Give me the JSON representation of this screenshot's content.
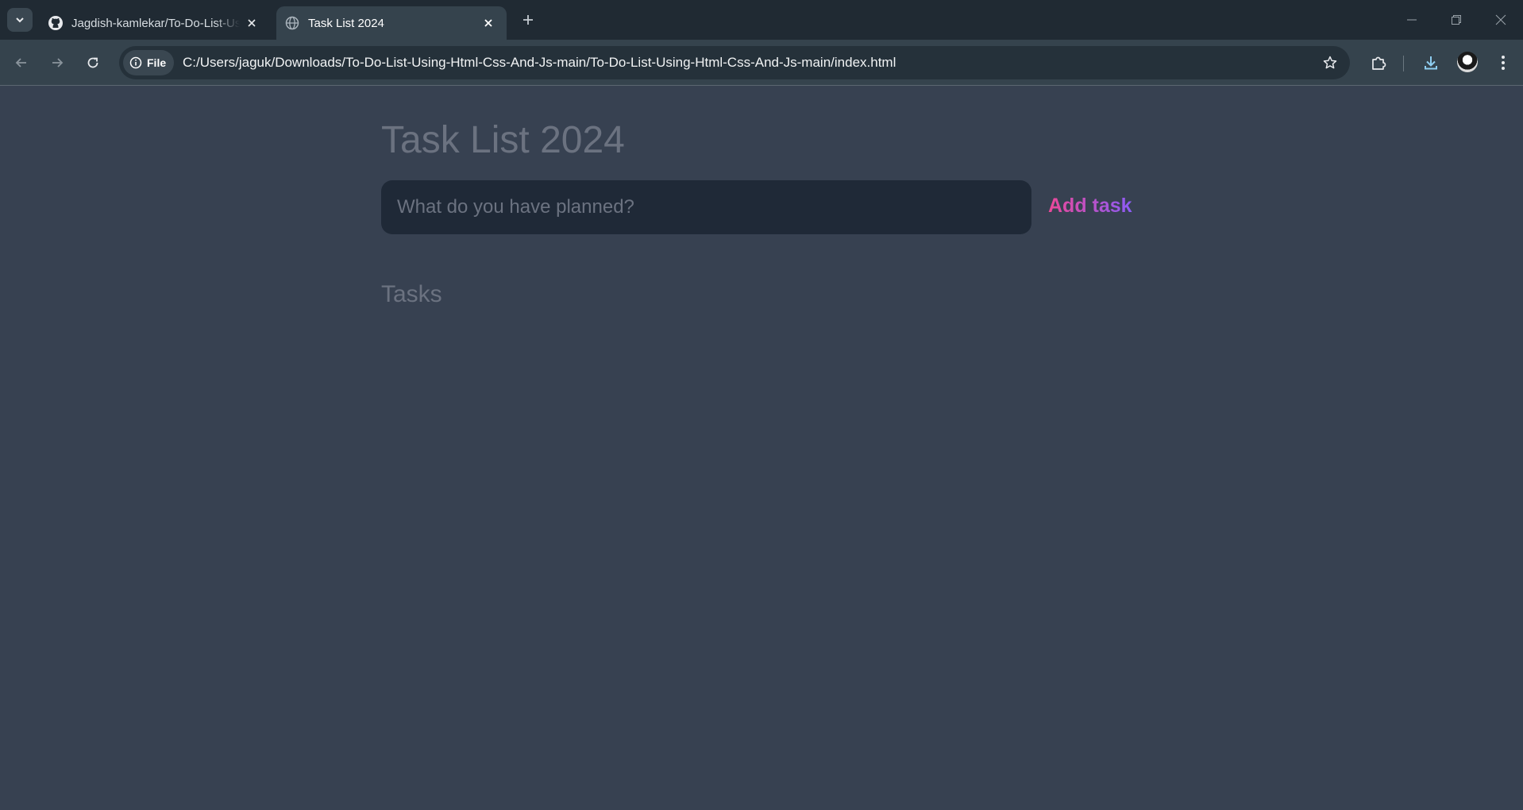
{
  "browser": {
    "tabs": [
      {
        "title": "Jagdish-kamlekar/To-Do-List-Using-Html-Css-And-Js",
        "icon": "github-icon",
        "active": false
      },
      {
        "title": "Task List 2024",
        "icon": "globe-icon",
        "active": true
      }
    ],
    "address": {
      "scheme_chip": "File",
      "url": "C:/Users/jaguk/Downloads/To-Do-List-Using-Html-Css-And-Js-main/To-Do-List-Using-Html-Css-And-Js-main/index.html"
    }
  },
  "app": {
    "title": "Task List 2024",
    "input_placeholder": "What do you have planned?",
    "add_button_label": "Add task",
    "tasks_heading": "Tasks",
    "tasks": []
  },
  "colors": {
    "page_background": "#374151",
    "input_background": "#1f2937",
    "muted_text": "#6b7280",
    "gradient_start": "#ec4899",
    "gradient_end": "#8b5cf6"
  }
}
